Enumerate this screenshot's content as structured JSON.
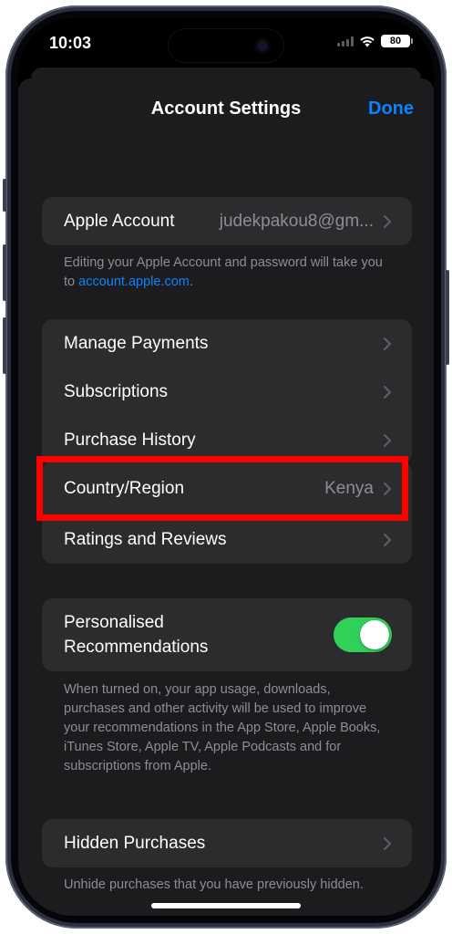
{
  "status_bar": {
    "time": "10:03",
    "battery": "80",
    "icons": [
      "dynamic-island",
      "cellular-signal-icon",
      "wifi-icon",
      "battery-icon"
    ]
  },
  "nav": {
    "title": "Account Settings",
    "done_label": "Done"
  },
  "apple_account": {
    "label": "Apple Account",
    "value": "judekpakou8@gm...",
    "footer_text": "Editing your Apple Account and password will take you to ",
    "footer_link": "account.apple.com",
    "footer_end": "."
  },
  "payments_group": [
    {
      "label": "Manage Payments"
    },
    {
      "label": "Subscriptions"
    },
    {
      "label": "Purchase History"
    }
  ],
  "region_group": [
    {
      "label": "Country/Region",
      "value": "Kenya"
    },
    {
      "label": "Ratings and Reviews"
    }
  ],
  "recommendations": {
    "label": "Personalised Recommendations",
    "enabled": true,
    "footer": "When turned on, your app usage, downloads, purchases and other activity will be used to improve your recommendations in the App Store, Apple Books, iTunes Store, Apple TV, Apple Podcasts and for subscriptions from Apple."
  },
  "hidden_purchases": {
    "label": "Hidden Purchases",
    "footer": "Unhide purchases that you have previously hidden."
  },
  "colors": {
    "accent": "#0a84ff",
    "toggle_on": "#30d158",
    "highlight": "#ff0000",
    "sheet_bg": "#1c1c1e",
    "cell_bg": "#2c2c2e",
    "secondary_text": "#8e8e93"
  }
}
